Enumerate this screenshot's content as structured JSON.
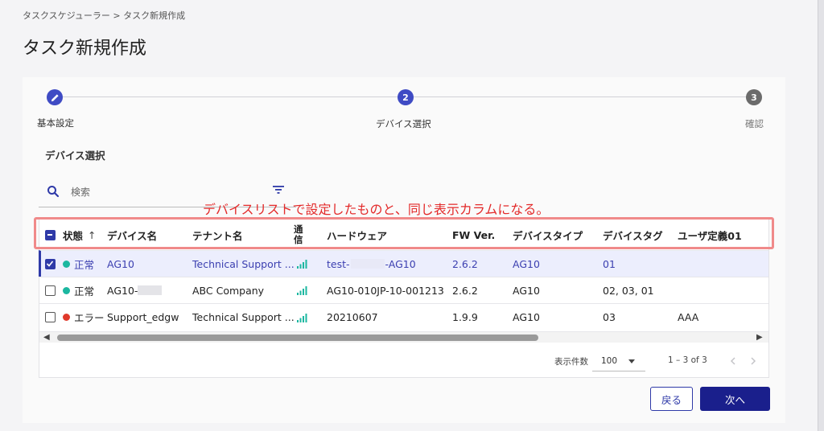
{
  "breadcrumb": {
    "parent": "タスクスケジューラー",
    "separator": ">",
    "current": "タスク新規作成"
  },
  "page_title": "タスク新規作成",
  "stepper": [
    {
      "number": "",
      "label": "基本設定",
      "state": "done"
    },
    {
      "number": "2",
      "label": "デバイス選択",
      "state": "active"
    },
    {
      "number": "3",
      "label": "確認",
      "state": "pending"
    }
  ],
  "section_title": "デバイス選択",
  "search": {
    "placeholder": "検索"
  },
  "annotation": "デバイスリストで設定したものと、同じ表示カラムになる。",
  "table": {
    "headers": {
      "status": "状態",
      "sort_arrow": "↑",
      "device_name": "デバイス名",
      "tenant_name": "テナント名",
      "signal_line1": "通",
      "signal_line2": "信",
      "hardware": "ハードウェア",
      "fw": "FW Ver.",
      "device_type": "デバイスタイプ",
      "device_tag": "デバイスタグ",
      "user_def": "ユーザ定義01"
    },
    "rows": [
      {
        "selected": true,
        "status": "正常",
        "status_color": "#1bb7a0",
        "device_name": "AG10",
        "tenant_name": "Technical Support ...",
        "hardware_prefix": "test-",
        "hardware_suffix": "-AG10",
        "hardware": "",
        "fw": "2.6.2",
        "device_type": "AG10",
        "device_tag": "01",
        "user_def": ""
      },
      {
        "selected": false,
        "status": "正常",
        "status_color": "#1bb7a0",
        "device_name": "AG10-",
        "tenant_name": "ABC Company",
        "hardware": "AG10-010JP-10-001213",
        "fw": "2.6.2",
        "device_type": "AG10",
        "device_tag": "02, 03, 01",
        "user_def": ""
      },
      {
        "selected": false,
        "status": "エラー",
        "status_color": "#e0392b",
        "device_name": "Support_edgw",
        "tenant_name": "Technical Support ...",
        "hardware": "20210607",
        "fw": "1.9.9",
        "device_type": "AG10",
        "device_tag": "03",
        "user_def": "AAA"
      }
    ]
  },
  "pagination": {
    "rows_per_page_label": "表示件数",
    "rows_per_page": "100",
    "range": "1 – 3 of 3"
  },
  "buttons": {
    "back": "戻る",
    "next": "次へ"
  },
  "colors": {
    "accent": "#2f3aa8",
    "step_active": "#3f4bc4",
    "step_pending": "#6b6b6b",
    "link": "#3b3fb0",
    "annotation": "#e32a2a"
  }
}
